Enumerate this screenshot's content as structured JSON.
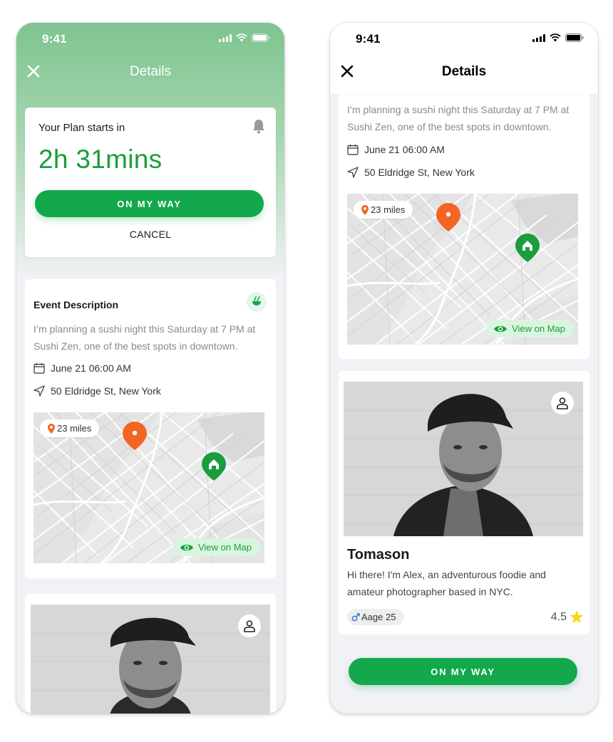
{
  "left_screen": {
    "status": {
      "time": "9:41"
    },
    "nav": {
      "title": "Details"
    },
    "plan": {
      "label": "Your Plan starts in",
      "countdown": "2h 31mins",
      "primary_button": "ON MY WAY",
      "cancel_button": "CANCEL"
    },
    "event": {
      "title": "Event Description",
      "description": "I’m planning a sushi night this Saturday at 7 PM at Sushi Zen, one of the best spots in downtown.",
      "date": "June 21 06:00 AM",
      "address": "50 Eldridge St, New York",
      "distance": "23 miles",
      "view_map": "View on Map"
    }
  },
  "right_screen": {
    "status": {
      "time": "9:41"
    },
    "nav": {
      "title": "Details"
    },
    "event": {
      "description": "I’m planning a sushi night this Saturday at 7 PM at Sushi Zen, one of the best spots in downtown.",
      "date": "June 21 06:00 AM",
      "address": "50 Eldridge St, New York",
      "distance": "23 miles",
      "view_map": "View on Map"
    },
    "profile": {
      "name": "Tomason",
      "bio": "Hi there! I'm Alex, an adventurous foodie and amateur photographer based in NYC.",
      "age": "Aage 25",
      "rating": "4.5"
    },
    "primary_button": "ON MY WAY"
  },
  "colors": {
    "accent_green": "#14a84c",
    "header_gradient_top": "#7ec48f",
    "pin_orange": "#f26522",
    "star_yellow": "#f5d80f"
  }
}
